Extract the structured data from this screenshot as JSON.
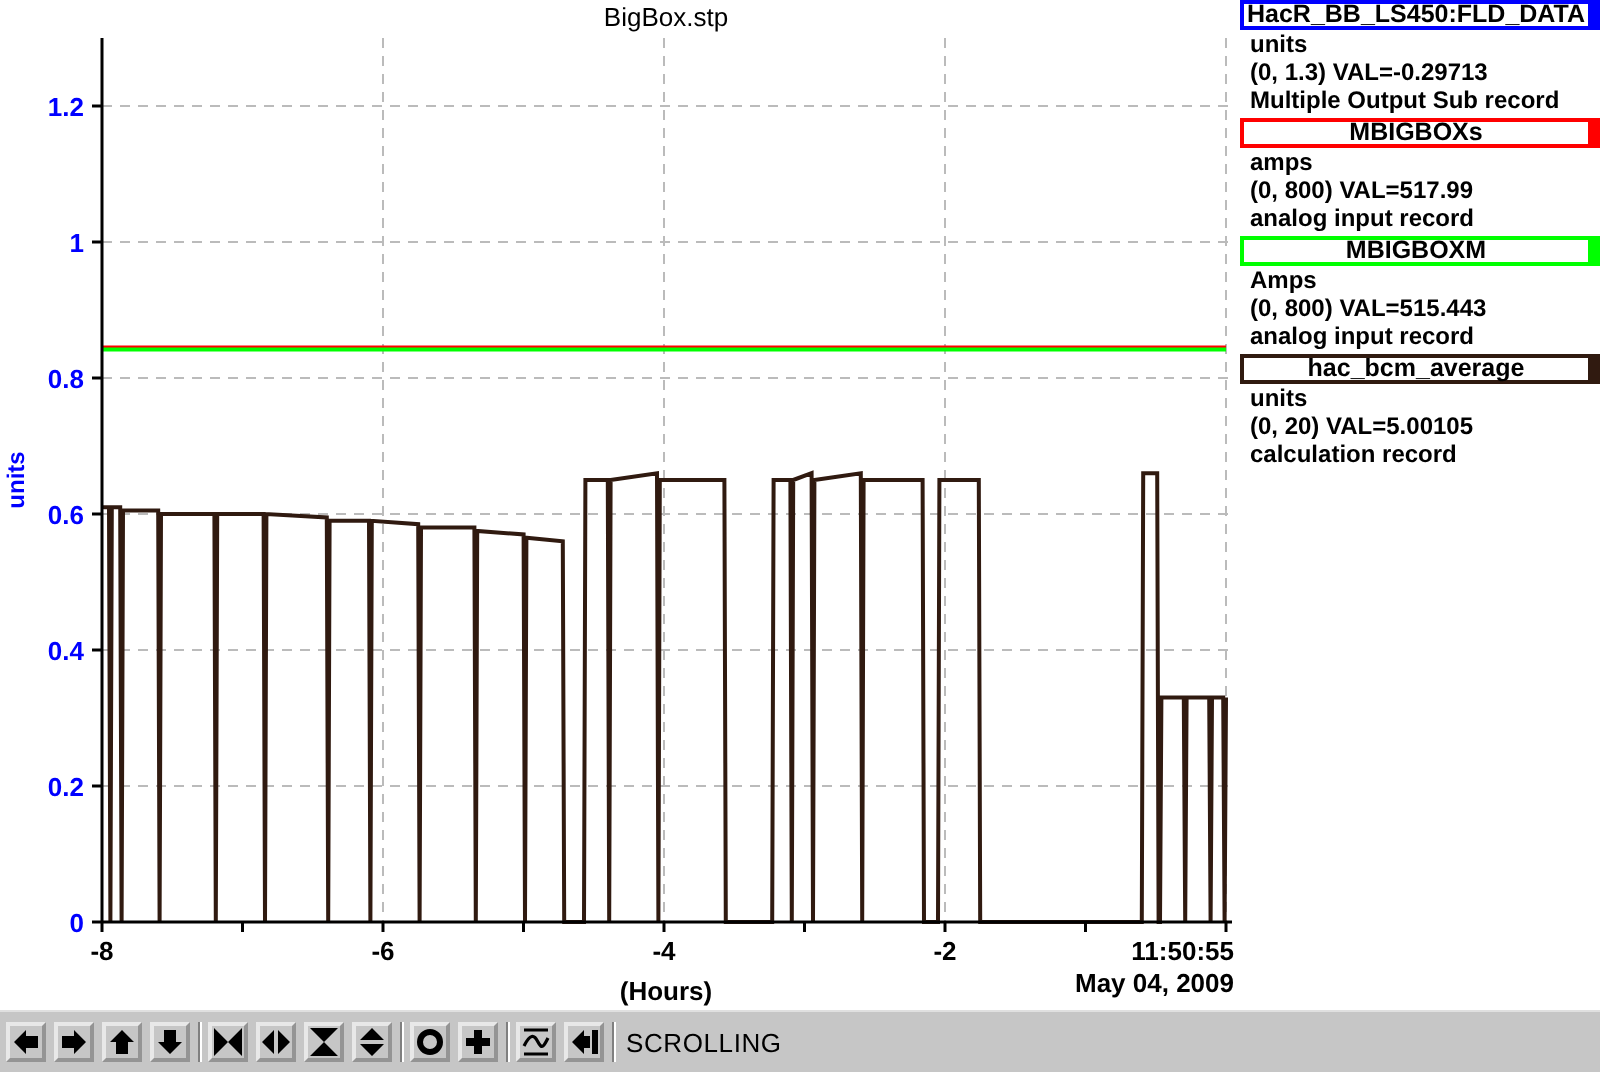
{
  "plot": {
    "time_label": "11:50:55",
    "date_label": "May 04, 2009",
    "chart_data": {
      "type": "line",
      "title": "BigBox.stp",
      "xlabel": "(Hours)",
      "ylabel": "units",
      "xlim": [
        -8,
        0
      ],
      "ylim": [
        0,
        1.3
      ],
      "grid": true,
      "xticks": [
        -8,
        -6,
        -4,
        -2
      ],
      "yticks": [
        0,
        0.2,
        0.4,
        0.6,
        0.8,
        1,
        1.2
      ],
      "x": [
        -8,
        -7.95,
        -7.94,
        -7.93,
        -7.87,
        -7.86,
        -7.85,
        -7.6,
        -7.59,
        -7.58,
        -7.2,
        -7.19,
        -7.18,
        -6.85,
        -6.84,
        -6.83,
        -6.4,
        -6.39,
        -6.38,
        -6.1,
        -6.09,
        -6.08,
        -5.75,
        -5.74,
        -5.73,
        -5.35,
        -5.34,
        -5.33,
        -5.0,
        -4.99,
        -4.98,
        -4.72,
        -4.71,
        -4.57,
        -4.56,
        -4.4,
        -4.39,
        -4.38,
        -4.05,
        -4.04,
        -4.03,
        -3.57,
        -3.56,
        -3.23,
        -3.22,
        -3.1,
        -3.09,
        -3.08,
        -2.95,
        -2.94,
        -2.93,
        -2.6,
        -2.59,
        -2.58,
        -2.16,
        -2.15,
        -2.05,
        -2.04,
        -1.76,
        -1.75,
        -0.6,
        -0.59,
        -0.49,
        -0.48,
        -0.47,
        -0.46,
        -0.3,
        -0.29,
        -0.28,
        -0.12,
        -0.11,
        -0.1,
        -0.02,
        -0.01,
        0
      ],
      "series": [
        {
          "name": "HacR_BB_LS450:FLD_DATA",
          "color": "#0000ff",
          "values": [
            null,
            null,
            null,
            null,
            null,
            null,
            null,
            null,
            null,
            null,
            null,
            null,
            null,
            null,
            null,
            null,
            null,
            null,
            null,
            null,
            null,
            null,
            null,
            null,
            null,
            null,
            null,
            null,
            null,
            null,
            null,
            null,
            null,
            null,
            null,
            null,
            null,
            null,
            null,
            null,
            null,
            null,
            null,
            null,
            null,
            null,
            null,
            null,
            null,
            null,
            null,
            null,
            null,
            null,
            null,
            null,
            null,
            null,
            null,
            null,
            null,
            null,
            null,
            null,
            null,
            null,
            null,
            null,
            null,
            null,
            null,
            null,
            null,
            null,
            null
          ]
        },
        {
          "name": "MBIGBOXs",
          "color": "#ff0000",
          "values": [
            0.845,
            0.845,
            0.845,
            0.845,
            0.845,
            0.845,
            0.845,
            0.845,
            0.845,
            0.845,
            0.845,
            0.845,
            0.845,
            0.845,
            0.845,
            0.845,
            0.845,
            0.845,
            0.845,
            0.845,
            0.845,
            0.845,
            0.845,
            0.845,
            0.845,
            0.845,
            0.845,
            0.845,
            0.845,
            0.845,
            0.845,
            0.845,
            0.845,
            0.845,
            0.845,
            0.845,
            0.845,
            0.845,
            0.845,
            0.845,
            0.845,
            0.845,
            0.845,
            0.845,
            0.845,
            0.845,
            0.845,
            0.845,
            0.845,
            0.845,
            0.845,
            0.845,
            0.845,
            0.845,
            0.845,
            0.845,
            0.845,
            0.845,
            0.845,
            0.845,
            0.845,
            0.845,
            0.845,
            0.845,
            0.845,
            0.845,
            0.845,
            0.845,
            0.845,
            0.845,
            0.845,
            0.845,
            0.845,
            0.845,
            0.845
          ]
        },
        {
          "name": "MBIGBOXM",
          "color": "#00ff00",
          "values": [
            0.842,
            0.842,
            0.842,
            0.842,
            0.842,
            0.842,
            0.842,
            0.842,
            0.842,
            0.842,
            0.842,
            0.842,
            0.842,
            0.842,
            0.842,
            0.842,
            0.842,
            0.842,
            0.842,
            0.842,
            0.842,
            0.842,
            0.842,
            0.842,
            0.842,
            0.842,
            0.842,
            0.842,
            0.842,
            0.842,
            0.842,
            0.842,
            0.842,
            0.842,
            0.842,
            0.842,
            0.842,
            0.842,
            0.842,
            0.842,
            0.842,
            0.842,
            0.842,
            0.842,
            0.842,
            0.842,
            0.842,
            0.842,
            0.842,
            0.842,
            0.842,
            0.842,
            0.842,
            0.842,
            0.842,
            0.842,
            0.842,
            0.842,
            0.842,
            0.842,
            0.842,
            0.842,
            0.842,
            0.842,
            0.842,
            0.842,
            0.842,
            0.842,
            0.842,
            0.842,
            0.842,
            0.842,
            0.842,
            0.842,
            0.842
          ]
        },
        {
          "name": "hac_bcm_average",
          "color": "#301a10",
          "values": [
            0.61,
            0.61,
            0,
            0.61,
            0.61,
            0,
            0.605,
            0.605,
            0,
            0.6,
            0.6,
            0,
            0.6,
            0.6,
            0,
            0.6,
            0.595,
            0,
            0.59,
            0.59,
            0,
            0.59,
            0.585,
            0,
            0.58,
            0.58,
            0,
            0.575,
            0.57,
            0,
            0.565,
            0.56,
            0,
            0,
            0.65,
            0.65,
            0,
            0.65,
            0.66,
            0,
            0.65,
            0.65,
            0,
            0,
            0.65,
            0.65,
            0,
            0.65,
            0.66,
            0,
            0.65,
            0.66,
            0,
            0.65,
            0.65,
            0,
            0,
            0.65,
            0.65,
            0,
            0,
            0.66,
            0.66,
            0,
            0,
            0.33,
            0.33,
            0,
            0.33,
            0.33,
            0,
            0.33,
            0.33,
            0,
            0.33
          ]
        }
      ]
    }
  },
  "legend": [
    {
      "units": "units",
      "reading": "(0, 1.3) VAL=-0.29713",
      "record_type": "Multiple Output Sub record"
    },
    {
      "units": "amps",
      "reading": "(0, 800) VAL=517.99",
      "record_type": "analog input record"
    },
    {
      "units": "Amps",
      "reading": "(0, 800) VAL=515.443",
      "record_type": "analog input record"
    },
    {
      "units": "units",
      "reading": "(0, 20) VAL=5.00105",
      "record_type": "calculation record"
    }
  ],
  "toolbar": {
    "groups": [
      [
        {
          "kind": "arrow-left"
        },
        {
          "kind": "arrow-right"
        },
        {
          "kind": "arrow-up"
        },
        {
          "kind": "arrow-down"
        }
      ],
      [
        {
          "kind": "compress-x"
        },
        {
          "kind": "expand-x"
        },
        {
          "kind": "compress-y"
        },
        {
          "kind": "expand-y"
        }
      ],
      [
        {
          "kind": "circle"
        },
        {
          "kind": "plus"
        }
      ],
      [
        {
          "kind": "wave"
        },
        {
          "kind": "jump-left"
        }
      ]
    ],
    "status": "SCROLLING"
  }
}
